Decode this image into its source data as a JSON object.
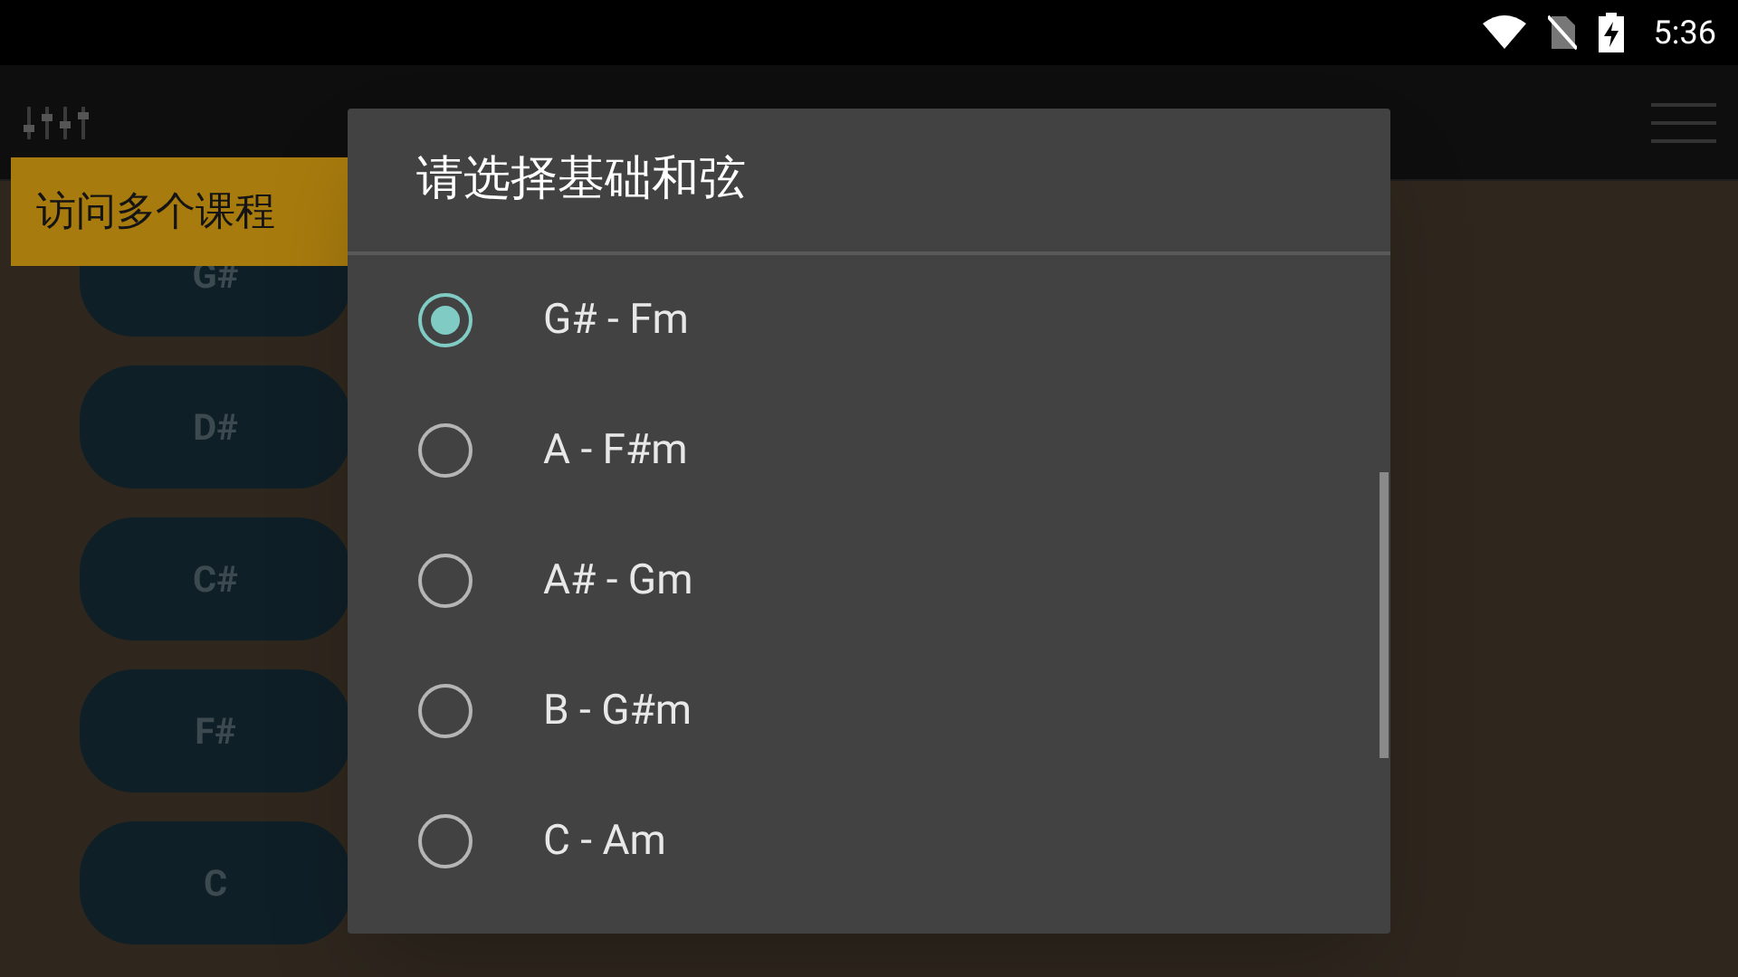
{
  "status_bar": {
    "time": "5:36"
  },
  "chord_buttons": [
    "G#",
    "D#",
    "C#",
    "F#",
    "C"
  ],
  "tooltip": {
    "text": "访问多个课程"
  },
  "dialog": {
    "title": "请选择基础和弦",
    "options": [
      {
        "label": "G# - Fm",
        "selected": true
      },
      {
        "label": "A - F#m",
        "selected": false
      },
      {
        "label": "A# - Gm",
        "selected": false
      },
      {
        "label": "B - G#m",
        "selected": false
      },
      {
        "label": "C - Am",
        "selected": false
      }
    ]
  }
}
